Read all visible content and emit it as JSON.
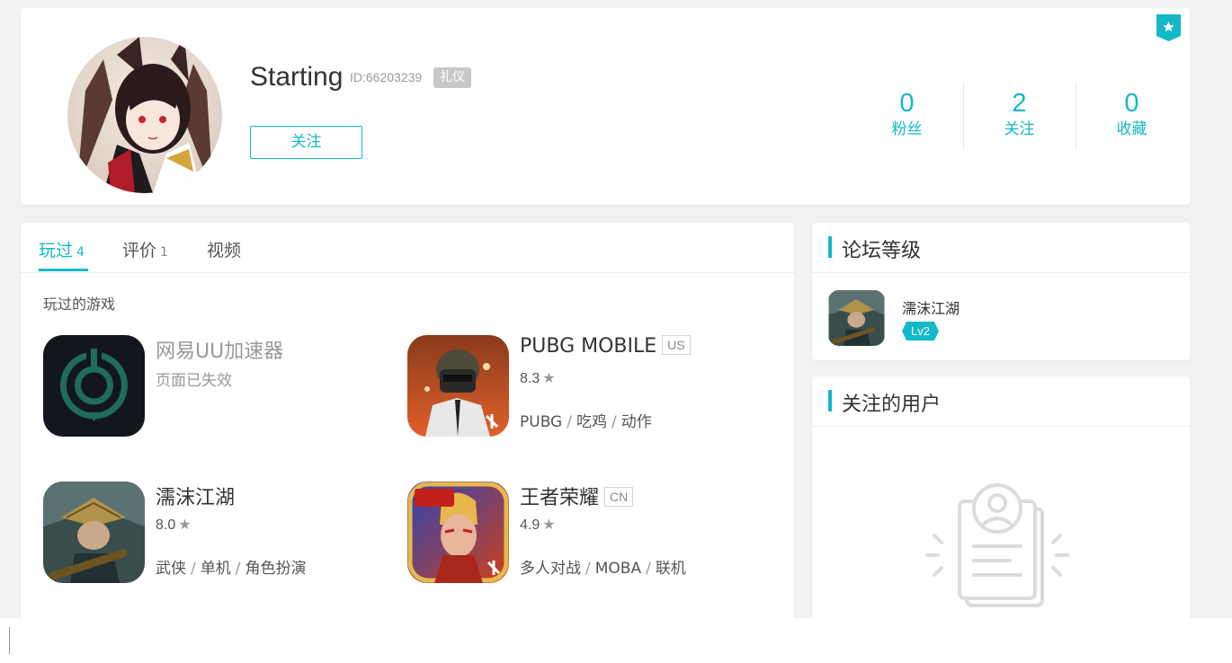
{
  "profile": {
    "username": "Starting",
    "uid": "ID:66203239",
    "title_badge": "礼仪",
    "follow_button": "关注",
    "stats": [
      {
        "value": "0",
        "label": "粉丝"
      },
      {
        "value": "2",
        "label": "关注"
      },
      {
        "value": "0",
        "label": "收藏"
      }
    ]
  },
  "tabs": [
    {
      "label": "玩过",
      "count": "4"
    },
    {
      "label": "评价",
      "count": "1"
    },
    {
      "label": "视频",
      "count": ""
    }
  ],
  "section_title": "玩过的游戏",
  "games": [
    {
      "name": "网易UU加速器",
      "subtitle": "页面已失效",
      "icon": "uu-accelerator-icon"
    },
    {
      "name": "PUBG MOBILE",
      "region": "US",
      "rating": "8.3",
      "tags": [
        "PUBG",
        "吃鸡",
        "动作"
      ],
      "icon": "pubg-icon"
    },
    {
      "name": "濡沫江湖",
      "rating": "8.0",
      "tags": [
        "武侠",
        "单机",
        "角色扮演"
      ],
      "icon": "rumo-jianghu-icon"
    },
    {
      "name": "王者荣耀",
      "region": "CN",
      "rating": "4.9",
      "tags": [
        "多人对战",
        "MOBA",
        "联机"
      ],
      "icon": "honor-of-kings-icon"
    }
  ],
  "forum_level": {
    "title": "论坛等级",
    "game_name": "濡沫江湖",
    "level": "Lv2"
  },
  "following_users": {
    "title": "关注的用户"
  },
  "colors": {
    "accent": "#14b9c8",
    "background": "#f2f2f2"
  }
}
